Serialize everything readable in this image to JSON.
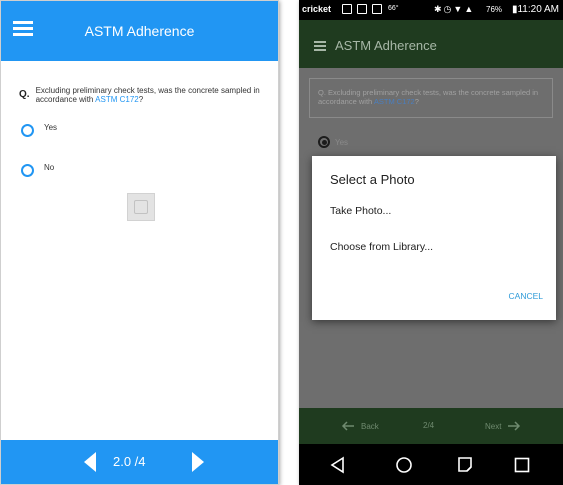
{
  "left_phone": {
    "app_title": "ASTM Adherence",
    "question_prefix": "Q.",
    "question_text": "Excluding preliminary check tests, was the concrete sampled in accordance with ",
    "question_link": "ASTM C172",
    "question_end": "?",
    "options": [
      "Yes",
      "No"
    ],
    "pagination": "2.0 /4",
    "accent_color": "#2196f3",
    "icons": {
      "menu": "hamburger-menu-icon",
      "prev": "chevron-left-icon",
      "next": "chevron-right-icon",
      "thumb": "photo-thumbnail-icon"
    }
  },
  "right_phone": {
    "status_bar": {
      "carrier": "cricket",
      "temperature": "66°",
      "battery": "76%",
      "time": "11:20 AM",
      "icons": [
        "bluetooth-icon",
        "alarm-icon",
        "wifi-icon",
        "signal-icon",
        "battery-icon"
      ]
    },
    "app_title": "ASTM Adherence",
    "question_text": "Q. Excluding preliminary check tests, was the concrete sampled in accordance with ",
    "question_link": "ASTM C172",
    "question_end": "?",
    "selected_option": "Yes",
    "dialog": {
      "title": "Select a Photo",
      "items": [
        "Take Photo...",
        "Choose from Library..."
      ],
      "cancel": "CANCEL"
    },
    "bottom_nav": {
      "back": "Back",
      "page": "2/4",
      "next": "Next"
    },
    "android_nav_icons": [
      "back-triangle-icon",
      "home-circle-icon",
      "recents-icon",
      "square-icon"
    ]
  }
}
